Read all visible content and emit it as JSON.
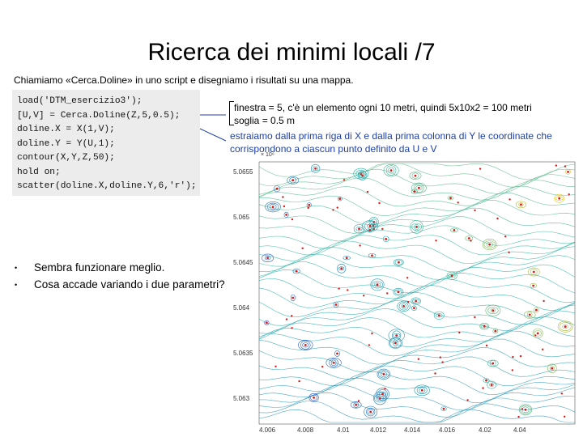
{
  "slide": {
    "title": "Ricerca dei minimi locali /7",
    "subtitle": "Chiamiamo «Cerca.Doline» in uno script e disegniamo i risultati su una mappa."
  },
  "code": {
    "lines": [
      "load('DTM_esercizio3');",
      "[U,V] = Cerca.Doline(Z,5,0.5);",
      "doline.X = X(1,V);",
      "doline.Y = Y(U,1);",
      "contour(X,Y,Z,50);",
      "hold on;",
      "scatter(doline.X,doline.Y,6,'r');"
    ]
  },
  "notes": {
    "window": "finestra = 5, c'è un elemento ogni 10 metri, quindi 5x10x2 = 100 metri",
    "threshold": "soglia = 0.5 m",
    "extract_line1": "estraiamo dalla prima riga di X e dalla prima colonna di Y le coordinate che",
    "extract_line2": "corrispondono a ciascun punto definito da U e V"
  },
  "bullets": [
    "Sembra funzionare meglio.",
    "Cosa accade variando i due parametri?"
  ],
  "map": {
    "y_exponent": "× 10⁶",
    "y_ticks": [
      "5.0655",
      "5.065",
      "5.0645",
      "5.064",
      "5.0635",
      "5.063"
    ],
    "x_ticks": [
      "4.006",
      "4.008",
      "4.01",
      "4.012",
      "4.014",
      "4.016",
      "4.02",
      "4.04"
    ],
    "colors": {
      "low": "#2a52c8",
      "mid": "#22b0a6",
      "high": "#e6c21a",
      "points": "#d61a1a"
    }
  }
}
